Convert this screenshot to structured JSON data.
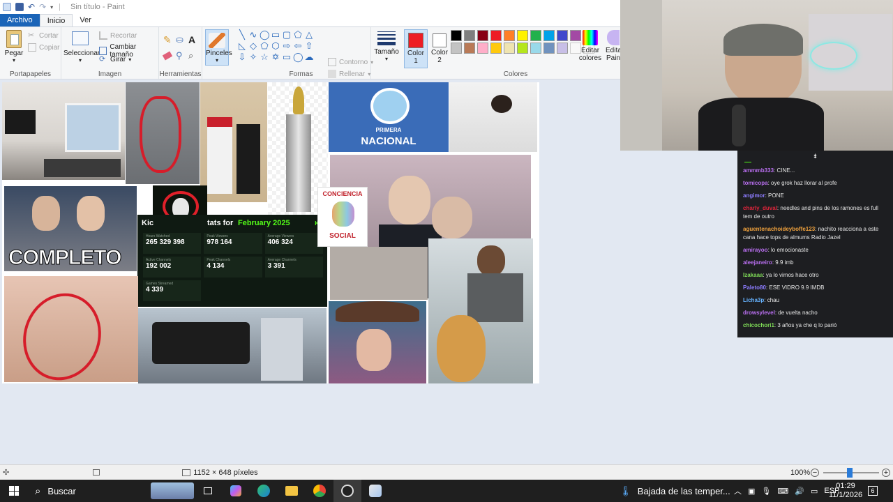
{
  "window": {
    "title": "Sin título - Paint"
  },
  "tabs": [
    "Archivo",
    "Inicio",
    "Ver"
  ],
  "ribbon": {
    "portapapeles": {
      "label": "Portapapeles",
      "paste": "Pegar",
      "cut": "Cortar",
      "copy": "Copiar"
    },
    "imagen": {
      "label": "Imagen",
      "select": "Seleccionar",
      "crop": "Recortar",
      "resize": "Cambiar tamaño",
      "rotate": "Girar"
    },
    "herramientas": {
      "label": "Herramientas"
    },
    "pinceles": {
      "label": "Pinceles"
    },
    "formas": {
      "label": "Formas",
      "outline": "Contorno",
      "fill": "Rellenar"
    },
    "size": {
      "label": "Tamaño"
    },
    "color1": {
      "label": "Color\n1",
      "line1": "Color",
      "line2": "1"
    },
    "color2": {
      "label": "Color\n2",
      "line1": "Color",
      "line2": "2"
    },
    "colores": {
      "label": "Colores",
      "edit_line1": "Editar",
      "edit_line2": "colores",
      "edit3d_partial": "Edita",
      "edit3d_partial2": "Pain"
    },
    "palette": [
      "#000000",
      "#7f7f7f",
      "#880015",
      "#ed1c24",
      "#ff7f27",
      "#fff200",
      "#22b14c",
      "#00a2e8",
      "#3f48cc",
      "#a349a4",
      "#ffffff",
      "#c3c3c3",
      "#b97a57",
      "#ffaec9",
      "#ffc90e",
      "#efe4b0",
      "#b5e61d",
      "#99d9ea",
      "#7092be",
      "#c8bfe7"
    ],
    "color1_value": "#ed1c24",
    "color2_value": "#ffffff"
  },
  "canvas": {
    "texts": {
      "completo": "COMPLETO",
      "primera": "PRIMERA",
      "nacional": "NACIONAL",
      "conciencia": "CONCIENCIA",
      "social": "SOCIAL",
      "stats_title_pre": "Kic",
      "stats_title": "tats for",
      "stats_month": "February 2025",
      "stats_kick": "KIC",
      "stats": [
        {
          "label": "Hours Watched",
          "value": "265 329 398"
        },
        {
          "label": "Peak Viewers",
          "value": "978 164"
        },
        {
          "label": "Average Viewers",
          "value": "406 324"
        },
        {
          "label": "Active Channels",
          "value": "192 002"
        },
        {
          "label": "Peak Channels",
          "value": "4 134"
        },
        {
          "label": "Average Channels",
          "value": "3 391"
        },
        {
          "label": "Games Streamed",
          "value": "4 339"
        }
      ]
    }
  },
  "chat": [
    {
      "user": "ammmb333",
      "text": "CINE...",
      "color": "#b96ff0"
    },
    {
      "user": "tomicopa",
      "text": "oye grok haz llorar al profe",
      "color": "#b96ff0"
    },
    {
      "user": "angimor",
      "text": "PONE",
      "color": "#8d7cff"
    },
    {
      "user": "charly_duval",
      "text": "needles and pins de los ramones es full tem de outro",
      "color": "#e0243b"
    },
    {
      "user": "aguentenachoideyboffe123",
      "text": "nachito reacciona a este cana hace tops de almums Radio Jazel",
      "color": "#f0a23d"
    },
    {
      "user": "amirayoo",
      "text": "lo emocionaste",
      "color": "#b96ff0"
    },
    {
      "user": "aleejaneiro",
      "text": "9.9 imb",
      "color": "#b96ff0"
    },
    {
      "user": "Izakaaa",
      "text": "ya lo vimos hace otro",
      "color": "#7ed957"
    },
    {
      "user": "Paleto80",
      "text": "ESE VIDRO 9.9 IMDB",
      "color": "#8d7cff"
    },
    {
      "user": "Licha3p",
      "text": "chau",
      "color": "#66b3ff"
    },
    {
      "user": "drowsylevel",
      "text": "de vuelta nacho",
      "color": "#b96ff0"
    },
    {
      "user": "chicochori1",
      "text": "3 años ya che q lo parió",
      "color": "#7ed957"
    }
  ],
  "statusbar": {
    "dimensions": "1152 × 648 píxeles",
    "zoom": "100%"
  },
  "taskbar": {
    "search": "Buscar",
    "weather": "Bajada de las temper...",
    "lang": "ESP",
    "time": "01:29",
    "date": "11/1/2026",
    "notif": "6"
  }
}
